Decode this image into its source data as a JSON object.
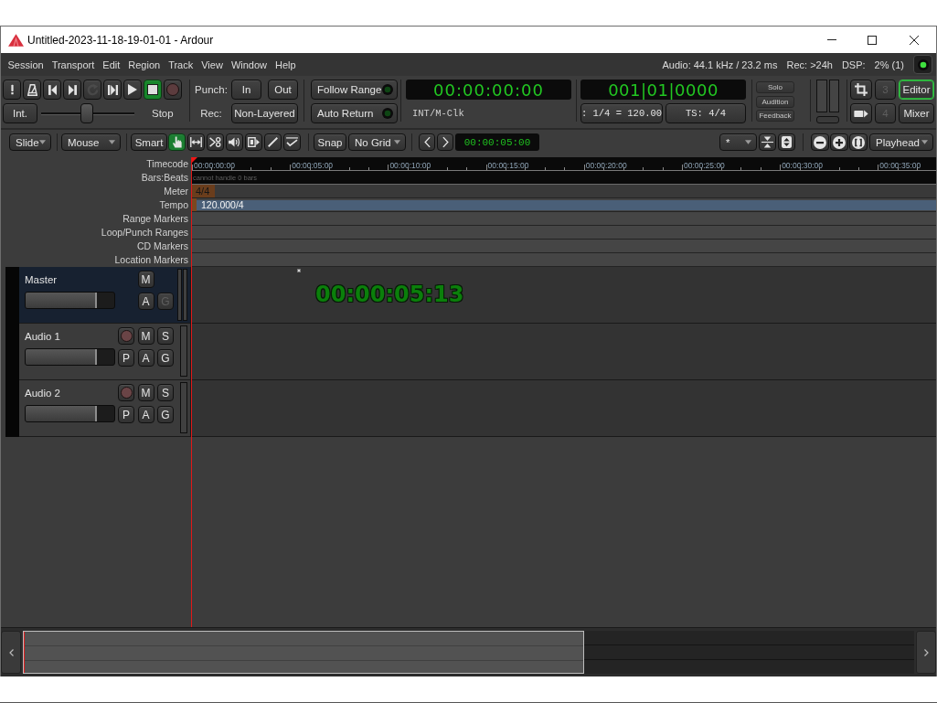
{
  "window": {
    "title": "Untitled-2023-11-18-19-01-01 - Ardour"
  },
  "menu": [
    "Session",
    "Transport",
    "Edit",
    "Region",
    "Track",
    "View",
    "Window",
    "Help"
  ],
  "status": {
    "audio": "Audio: 44.1 kHz / 23.2 ms",
    "rec": "Rec: >24h",
    "dsp_label": "DSP:",
    "dsp": "2% (1)",
    "led_on": true
  },
  "transport": {
    "buttons": [
      {
        "kind": "panic",
        "on": false,
        "disabled": false
      },
      {
        "kind": "metronome",
        "on": false,
        "disabled": false
      },
      {
        "kind": "start",
        "on": false,
        "disabled": false
      },
      {
        "kind": "end",
        "on": false,
        "disabled": false
      },
      {
        "kind": "loop",
        "on": false,
        "disabled": true
      },
      {
        "kind": "range",
        "on": false,
        "disabled": false
      },
      {
        "kind": "play",
        "on": false,
        "disabled": false
      },
      {
        "kind": "stop",
        "on": true,
        "disabled": false
      },
      {
        "kind": "record",
        "on": false,
        "disabled": false
      }
    ],
    "shuttle_mode": "Int.",
    "shuttle": {
      "level": 0.49
    },
    "shuttle_state": "Stop"
  },
  "punch": {
    "label": "Punch:",
    "in": "In",
    "out": "Out",
    "rec_label": "Rec:",
    "rec_mode": "Non-Layered"
  },
  "options": [
    {
      "label": "Follow Range",
      "on": false
    },
    {
      "label": "Auto Return",
      "on": false
    }
  ],
  "primary_clock": {
    "time": "00:00:00:00",
    "source": "INT/M-Clk"
  },
  "secondary_clock": {
    "time": "001|01|0000",
    "tempo": ": 1/4 = 120.00",
    "meter": "TS: 4/4"
  },
  "monitor": [
    "Solo",
    "Audition",
    "Feedback"
  ],
  "windows": [
    {
      "kind": "edit",
      "number": "3",
      "number_disabled": true,
      "label": "Editor",
      "selected": true
    },
    {
      "kind": "mix",
      "number": "4",
      "number_disabled": true,
      "label": "Mixer",
      "selected": false
    }
  ],
  "edit_toolbar": {
    "edit_mode": "Slide",
    "mouse_mode": "Mouse",
    "smart": "Smart",
    "tools": [
      {
        "kind": "grab",
        "selected": true
      },
      {
        "kind": "range",
        "selected": false
      },
      {
        "kind": "cut",
        "selected": false
      },
      {
        "kind": "audition",
        "selected": false
      },
      {
        "kind": "stretch",
        "selected": false
      },
      {
        "kind": "draw",
        "selected": false
      },
      {
        "kind": "content",
        "selected": false
      }
    ],
    "snap": "Snap",
    "grid": "No Grid",
    "nudge_clock": "00:00:05:00",
    "visible_tracks": "*",
    "zoom_focus": "Playhead"
  },
  "rulers": [
    {
      "label": "Timecode",
      "kind": "timecode",
      "ticks": [
        "00:00:00:00",
        "00:00:05:00",
        "00:00:10:00",
        "00:00:15:00",
        "00:00:20:00",
        "00:00:25:00",
        "00:00:30:00",
        "00:00:35:00"
      ]
    },
    {
      "label": "Bars:Beats",
      "kind": "bbt",
      "text": "cannot handle 0 bars"
    },
    {
      "label": "Meter",
      "kind": "meter",
      "marker": "4/4"
    },
    {
      "label": "Tempo",
      "kind": "tempo",
      "marker": "120.000/4"
    },
    {
      "label": "Range Markers",
      "kind": "markers"
    },
    {
      "label": "Loop/Punch Ranges",
      "kind": "markers"
    },
    {
      "label": "CD Markers",
      "kind": "markers"
    },
    {
      "label": "Location Markers",
      "kind": "markers"
    }
  ],
  "tracks": [
    {
      "name": "Master",
      "kind": "master",
      "selected": true,
      "level": 0.8,
      "rows": [
        [
          {
            "kind": "text",
            "label": "M",
            "disabled": false
          }
        ],
        [
          {
            "kind": "text",
            "label": "A",
            "disabled": false
          },
          {
            "kind": "text",
            "label": "G",
            "disabled": true
          }
        ]
      ]
    },
    {
      "name": "Audio 1",
      "kind": "audio",
      "selected": false,
      "level": 0.8,
      "rows": [
        [
          {
            "kind": "rec",
            "armed": false
          },
          {
            "kind": "text",
            "label": "M",
            "disabled": false
          },
          {
            "kind": "text",
            "label": "S",
            "disabled": false
          }
        ],
        [
          {
            "kind": "text",
            "label": "P",
            "disabled": false
          },
          {
            "kind": "text",
            "label": "A",
            "disabled": false
          },
          {
            "kind": "text",
            "label": "G",
            "disabled": false
          }
        ]
      ]
    },
    {
      "name": "Audio 2",
      "kind": "audio",
      "selected": false,
      "level": 0.8,
      "rows": [
        [
          {
            "kind": "rec",
            "armed": false
          },
          {
            "kind": "text",
            "label": "M",
            "disabled": false
          },
          {
            "kind": "text",
            "label": "S",
            "disabled": false
          }
        ],
        [
          {
            "kind": "text",
            "label": "P",
            "disabled": false
          },
          {
            "kind": "text",
            "label": "A",
            "disabled": false
          },
          {
            "kind": "text",
            "label": "G",
            "disabled": false
          }
        ]
      ]
    }
  ],
  "canvas_clock": "00:00:05:13"
}
